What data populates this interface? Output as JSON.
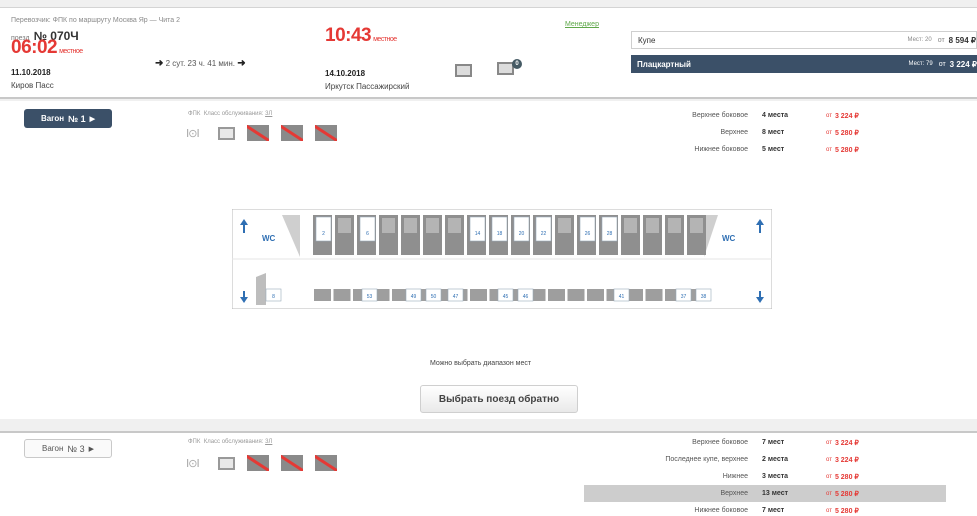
{
  "train": {
    "carrier_route": "Перевозчик: ФПК  по маршруту Москва Яр — Чита 2",
    "number_prefix": "поезд",
    "number": "№ 070Ч",
    "manager_link": "Менеджер"
  },
  "departure": {
    "time": "06:02",
    "time_note": "местное",
    "date": "11.10.2018",
    "station": "Киров Пасс"
  },
  "duration": {
    "text": "2 сут. 23 ч. 41 мин."
  },
  "arrival": {
    "time": "10:43",
    "time_note": "местное",
    "date": "14.10.2018",
    "station": "Иркутск Пассажирский"
  },
  "header_badge": "0",
  "classes": [
    {
      "name": "Купе",
      "seats": "Мест: 20",
      "from": "от",
      "price": "8 594 ₽",
      "selected": false
    },
    {
      "name": "Плацкартный",
      "seats": "Мест: 79",
      "from": "от",
      "price": "3 224 ₽",
      "selected": true
    }
  ],
  "wagons": [
    {
      "label": "Вагон",
      "number": "№ 1",
      "carrier": "ФПК",
      "service_label": "Класс обслуживания:",
      "service_class": "3Л",
      "fares": [
        {
          "type": "Верхнее боковое",
          "count": "4 места",
          "from": "от",
          "price": "3 224 ₽"
        },
        {
          "type": "Верхнее",
          "count": "8 мест",
          "from": "от",
          "price": "5 280 ₽"
        },
        {
          "type": "Нижнее боковое",
          "count": "5 мест",
          "from": "от",
          "price": "5 280 ₽"
        }
      ]
    },
    {
      "label": "Вагон",
      "number": "№ 3",
      "carrier": "ФПК",
      "service_label": "Класс обслуживания:",
      "service_class": "3Л",
      "fares": [
        {
          "type": "Верхнее боковое",
          "count": "7 мест",
          "from": "от",
          "price": "3 224 ₽"
        },
        {
          "type": "Последнее купе, верхнее",
          "count": "2 места",
          "from": "от",
          "price": "3 224 ₽"
        },
        {
          "type": "Нижнее",
          "count": "3 места",
          "from": "от",
          "price": "5 280 ₽"
        },
        {
          "type": "Верхнее",
          "count": "13 мест",
          "from": "от",
          "price": "5 280 ₽"
        },
        {
          "type": "Нижнее боковое",
          "count": "7 мест",
          "from": "от",
          "price": "5 280 ₽"
        }
      ]
    }
  ],
  "scheme": {
    "wc_label": "WC",
    "upper_free": [
      "2",
      "6",
      "14",
      "18",
      "20",
      "22",
      "26",
      "28"
    ],
    "lower_free": [
      "8",
      "53",
      "49",
      "50",
      "47",
      "45",
      "46",
      "41",
      "37",
      "38"
    ]
  },
  "range_note": "Можно выбрать диапазон мест",
  "back_button": "Выбрать поезд обратно",
  "colors": {
    "accent_dark": "#3b5068",
    "price_red": "#e53935",
    "manager_green": "#5fa84a"
  }
}
